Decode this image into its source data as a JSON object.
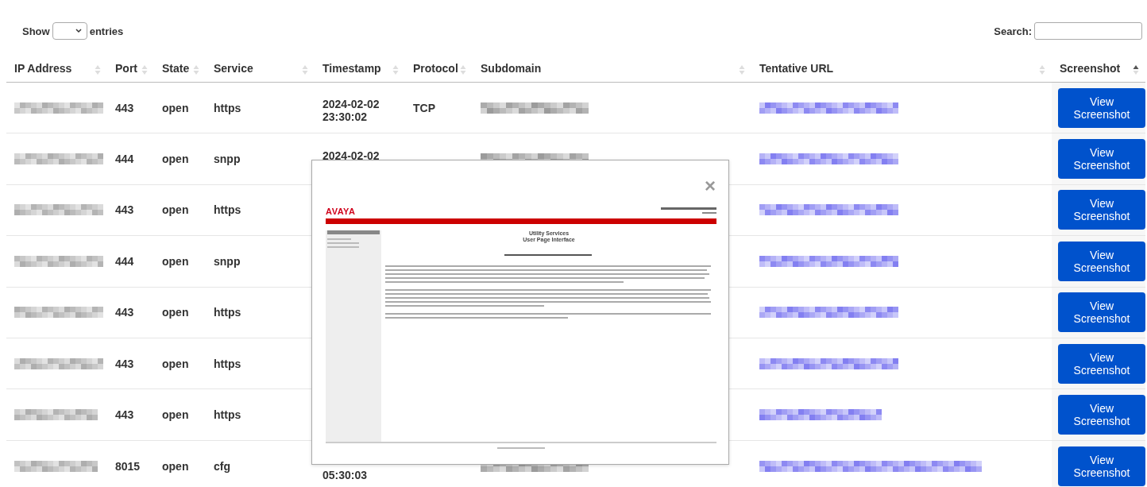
{
  "controls": {
    "show_label": "Show",
    "entries_label": "entries",
    "search_label": "Search:"
  },
  "table": {
    "columns": [
      {
        "label": "IP Address",
        "sorted": false
      },
      {
        "label": "Port",
        "sorted": false
      },
      {
        "label": "State",
        "sorted": false
      },
      {
        "label": "Service",
        "sorted": false
      },
      {
        "label": "Timestamp",
        "sorted": false
      },
      {
        "label": "Protocol",
        "sorted": false
      },
      {
        "label": "Subdomain",
        "sorted": false
      },
      {
        "label": "Tentative URL",
        "sorted": false
      },
      {
        "label": "Screenshot",
        "sorted": true
      }
    ],
    "rows": [
      {
        "port": "443",
        "state": "open",
        "service": "https",
        "date": "2024-02-02",
        "time": "23:30:02",
        "protocol": "TCP",
        "action": "View Screenshot"
      },
      {
        "port": "444",
        "state": "open",
        "service": "snpp",
        "date": "2024-02-02",
        "action": "View Screenshot"
      },
      {
        "port": "443",
        "state": "open",
        "service": "https",
        "action": "View Screenshot"
      },
      {
        "port": "444",
        "state": "open",
        "service": "snpp",
        "action": "View Screenshot"
      },
      {
        "port": "443",
        "state": "open",
        "service": "https",
        "action": "View Screenshot"
      },
      {
        "port": "443",
        "state": "open",
        "service": "https",
        "action": "View Screenshot"
      },
      {
        "port": "443",
        "state": "open",
        "service": "https",
        "action": "View Screenshot"
      },
      {
        "port": "8015",
        "state": "open",
        "service": "cfg",
        "time": "05:30:03",
        "action": "View Screenshot"
      }
    ]
  },
  "modal": {
    "close": "×",
    "page": {
      "logo": "AVAYA",
      "title": "Utility Services",
      "subtitle": "User Page Interface"
    }
  }
}
